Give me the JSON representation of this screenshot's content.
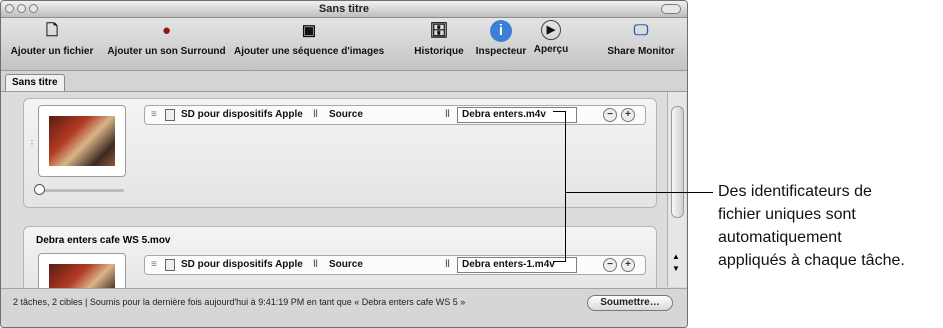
{
  "window": {
    "title": "Sans titre"
  },
  "toolbar": {
    "add_file": "Ajouter un fichier",
    "add_surround": "Ajouter un son Surround",
    "add_image_seq": "Ajouter une séquence d'images",
    "history": "Historique",
    "inspector": "Inspecteur",
    "preview": "Aperçu",
    "share_monitor": "Share Monitor"
  },
  "tab": {
    "label": "Sans titre"
  },
  "jobs": [
    {
      "source_name": "",
      "setting": "SD pour dispositifs Apple",
      "destination": "Source",
      "output_file": "Debra enters.m4v"
    },
    {
      "source_name": "Debra enters cafe WS 5.mov",
      "setting": "SD pour dispositifs Apple",
      "destination": "Source",
      "output_file": "Debra enters-1.m4v"
    }
  ],
  "status": {
    "summary": "2 tâches, 2 cibles  |  Soumis pour la dernière fois aujourd'hui à 9:41:19 PM en tant que « Debra enters cafe WS 5 »",
    "submit_label": "Soumettre…"
  },
  "callout": {
    "line1": "Des identificateurs de",
    "line2": "fichier uniques sont",
    "line3": "automatiquement",
    "line4": "appliqués à chaque tâche."
  }
}
